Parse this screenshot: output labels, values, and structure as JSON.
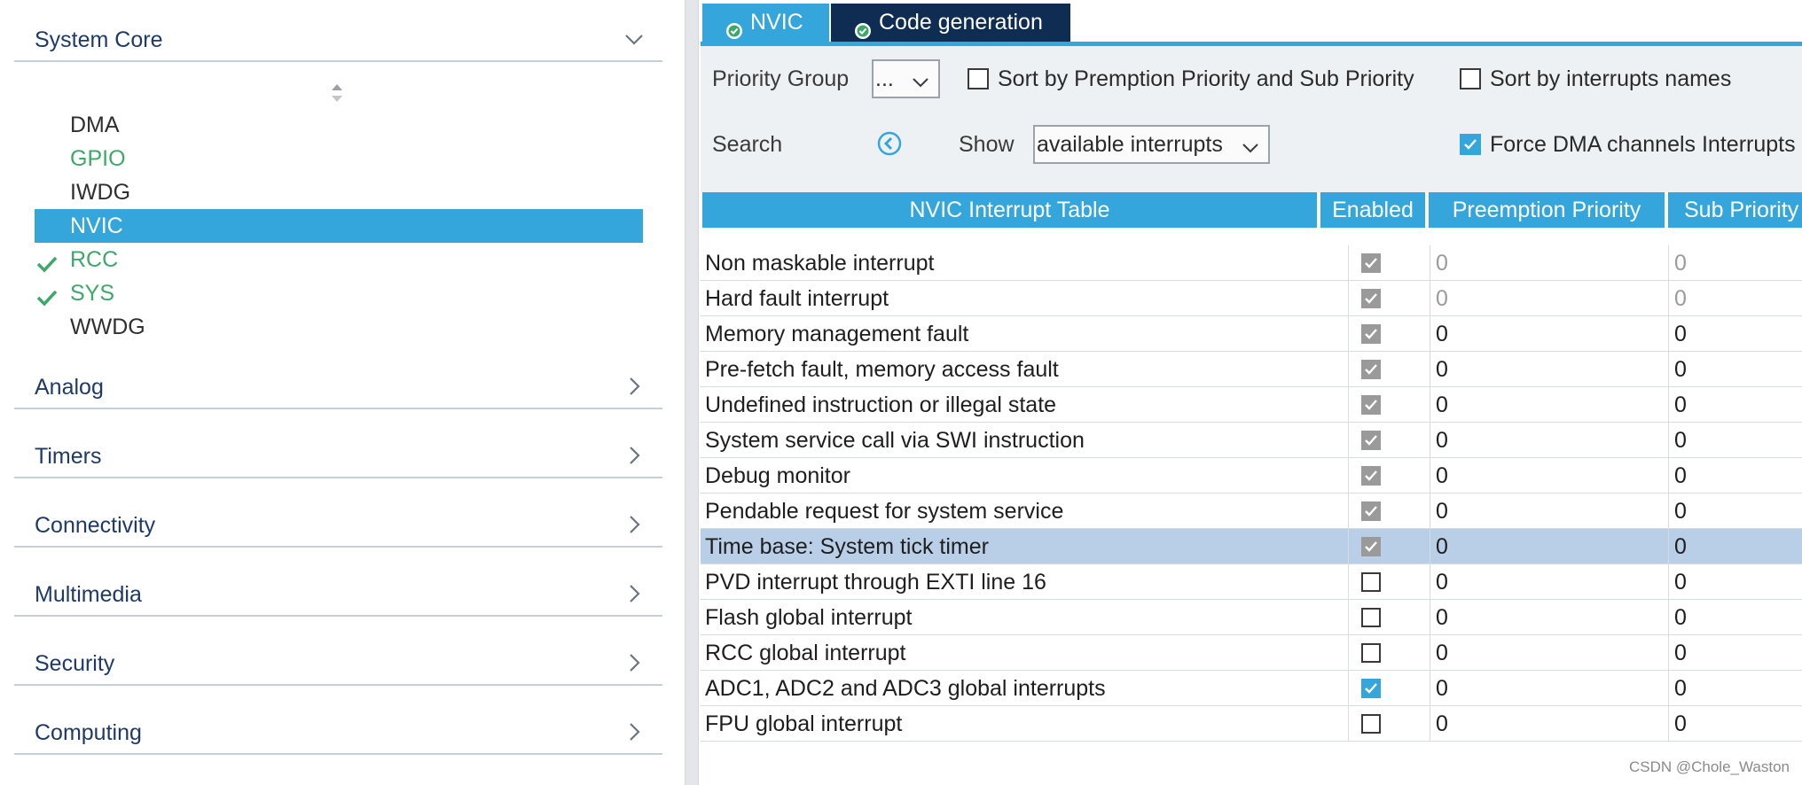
{
  "left_panel": {
    "system_core": {
      "label": "System Core"
    },
    "items": [
      {
        "label": "DMA",
        "state": "normal",
        "checked": false
      },
      {
        "label": "GPIO",
        "state": "green",
        "checked": false
      },
      {
        "label": "IWDG",
        "state": "normal",
        "checked": false
      },
      {
        "label": "NVIC",
        "state": "selected",
        "checked": false
      },
      {
        "label": "RCC",
        "state": "green",
        "checked": true
      },
      {
        "label": "SYS",
        "state": "green",
        "checked": true
      },
      {
        "label": "WWDG",
        "state": "normal",
        "checked": false
      }
    ],
    "categories": [
      {
        "label": "Analog"
      },
      {
        "label": "Timers"
      },
      {
        "label": "Connectivity"
      },
      {
        "label": "Multimedia"
      },
      {
        "label": "Security"
      },
      {
        "label": "Computing"
      }
    ]
  },
  "tabs": [
    {
      "label": "NVIC",
      "icon": "check-circle-icon"
    },
    {
      "label": "Code generation",
      "icon": "check-circle-icon"
    }
  ],
  "toolbar": {
    "priority_group_label": "Priority Group",
    "priority_group_value": "...",
    "sort_premption_label": "Sort by Premption Priority and Sub Priority",
    "sort_premption_checked": false,
    "sort_names_label": "Sort by interrupts names",
    "sort_names_checked": false,
    "search_label": "Search",
    "show_label": "Show",
    "show_value": "available interrupts",
    "force_dma_label": "Force DMA channels Interrupts",
    "force_dma_checked": true
  },
  "table": {
    "headers": {
      "name": "NVIC Interrupt Table",
      "enabled": "Enabled",
      "preemption": "Preemption Priority",
      "sub": "Sub Priority"
    },
    "rows": [
      {
        "name": "Non maskable interrupt",
        "enabled": true,
        "locked": true,
        "preemption": "0",
        "sub": "0",
        "muted": true,
        "highlight": false
      },
      {
        "name": "Hard fault interrupt",
        "enabled": true,
        "locked": true,
        "preemption": "0",
        "sub": "0",
        "muted": true,
        "highlight": false
      },
      {
        "name": "Memory management fault",
        "enabled": true,
        "locked": true,
        "preemption": "0",
        "sub": "0",
        "muted": false,
        "highlight": false
      },
      {
        "name": "Pre-fetch fault, memory access fault",
        "enabled": true,
        "locked": true,
        "preemption": "0",
        "sub": "0",
        "muted": false,
        "highlight": false
      },
      {
        "name": "Undefined instruction or illegal state",
        "enabled": true,
        "locked": true,
        "preemption": "0",
        "sub": "0",
        "muted": false,
        "highlight": false
      },
      {
        "name": "System service call via SWI instruction",
        "enabled": true,
        "locked": true,
        "preemption": "0",
        "sub": "0",
        "muted": false,
        "highlight": false
      },
      {
        "name": "Debug monitor",
        "enabled": true,
        "locked": true,
        "preemption": "0",
        "sub": "0",
        "muted": false,
        "highlight": false
      },
      {
        "name": "Pendable request for system service",
        "enabled": true,
        "locked": true,
        "preemption": "0",
        "sub": "0",
        "muted": false,
        "highlight": false
      },
      {
        "name": "Time base: System tick timer",
        "enabled": true,
        "locked": true,
        "preemption": "0",
        "sub": "0",
        "muted": false,
        "highlight": true
      },
      {
        "name": "PVD interrupt through EXTI line 16",
        "enabled": false,
        "locked": false,
        "preemption": "0",
        "sub": "0",
        "muted": false,
        "highlight": false
      },
      {
        "name": "Flash global interrupt",
        "enabled": false,
        "locked": false,
        "preemption": "0",
        "sub": "0",
        "muted": false,
        "highlight": false
      },
      {
        "name": "RCC global interrupt",
        "enabled": false,
        "locked": false,
        "preemption": "0",
        "sub": "0",
        "muted": false,
        "highlight": false
      },
      {
        "name": "ADC1, ADC2 and ADC3 global interrupts",
        "enabled": true,
        "locked": false,
        "preemption": "0",
        "sub": "0",
        "muted": false,
        "highlight": false
      },
      {
        "name": "FPU global interrupt",
        "enabled": false,
        "locked": false,
        "preemption": "0",
        "sub": "0",
        "muted": false,
        "highlight": false
      }
    ]
  },
  "watermark": "CSDN @Chole_Waston",
  "colors": {
    "accent": "#34a6db",
    "dark_tab": "#0f2d52",
    "green": "#3ea86b",
    "highlight_row": "#b9cfe7"
  }
}
